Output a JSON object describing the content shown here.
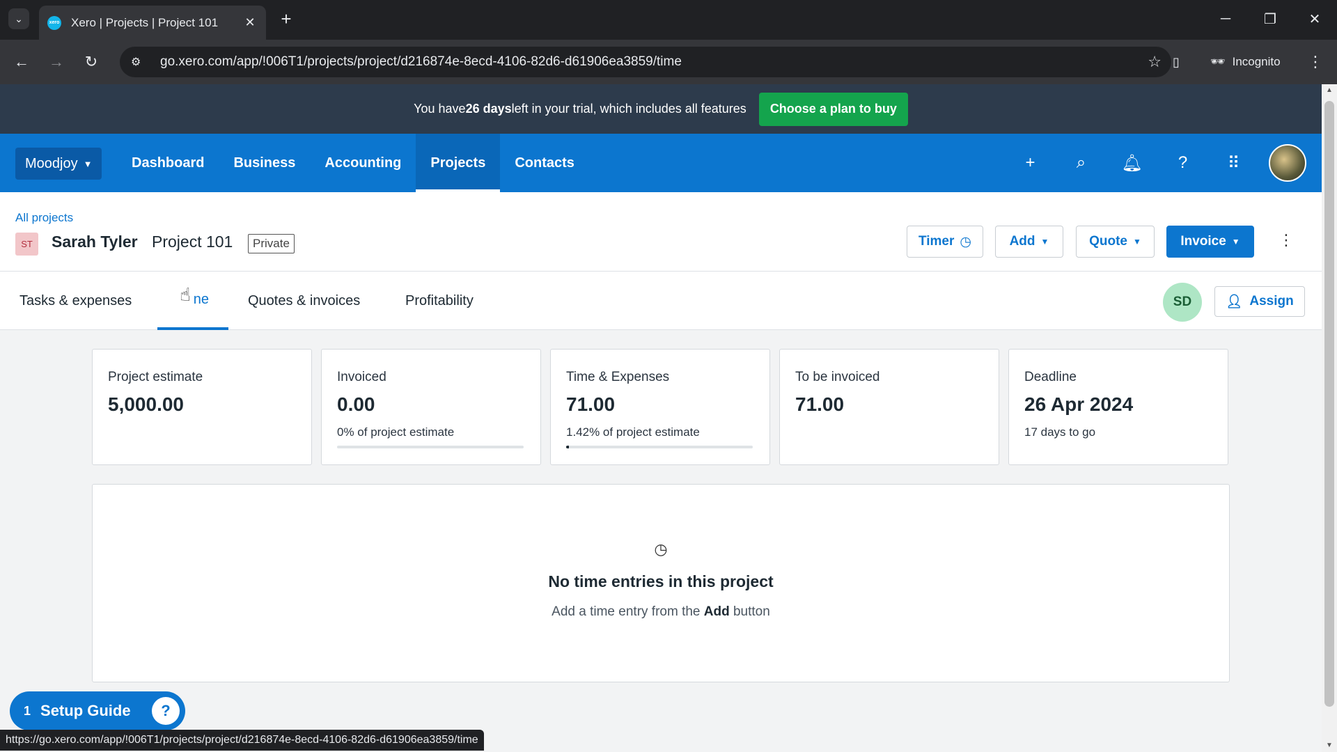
{
  "browser": {
    "tab_title": "Xero | Projects | Project 101",
    "url": "go.xero.com/app/!006T1/projects/project/d216874e-8ecd-4106-82d6-d61906ea3859/time",
    "incognito_label": "Incognito",
    "status_url": "https://go.xero.com/app/!006T1/projects/project/d216874e-8ecd-4106-82d6-d61906ea3859/time"
  },
  "trial_banner": {
    "prefix": "You have ",
    "days": "26 days",
    "suffix": " left in your trial, which includes all features",
    "cta": "Choose a plan to buy"
  },
  "nav": {
    "org": "Moodjoy",
    "links": [
      "Dashboard",
      "Business",
      "Accounting",
      "Projects",
      "Contacts"
    ],
    "active": "Projects"
  },
  "project": {
    "breadcrumb": "All projects",
    "contact_initials": "ST",
    "contact_name": "Sarah Tyler",
    "project_name": "Project 101",
    "visibility": "Private",
    "buttons": {
      "timer": "Timer",
      "add": "Add",
      "quote": "Quote",
      "invoice": "Invoice"
    }
  },
  "tabs": {
    "items": [
      "Tasks & expenses",
      "Time",
      "Quotes & invoices",
      "Profitability"
    ],
    "active_visible_text": "ne",
    "assignee_initials": "SD",
    "assign_label": "Assign"
  },
  "cards": [
    {
      "label": "Project estimate",
      "value": "5,000.00",
      "sub": ""
    },
    {
      "label": "Invoiced",
      "value": "0.00",
      "sub": "0% of project estimate",
      "progress": 0
    },
    {
      "label": "Time & Expenses",
      "value": "71.00",
      "sub": "1.42% of project estimate",
      "progress": 1.42
    },
    {
      "label": "To be invoiced",
      "value": "71.00",
      "sub": ""
    },
    {
      "label": "Deadline",
      "value": "26 Apr 2024",
      "sub": "17 days to go"
    }
  ],
  "empty_state": {
    "title": "No time entries in this project",
    "hint_prefix": "Add a time entry from the ",
    "hint_bold": "Add",
    "hint_suffix": " button"
  },
  "setup_guide": {
    "count": "1",
    "label": "Setup Guide"
  },
  "colors": {
    "xero_blue": "#0c76cf",
    "banner_bg": "#2d3b4c",
    "cta_green": "#14a44d"
  }
}
